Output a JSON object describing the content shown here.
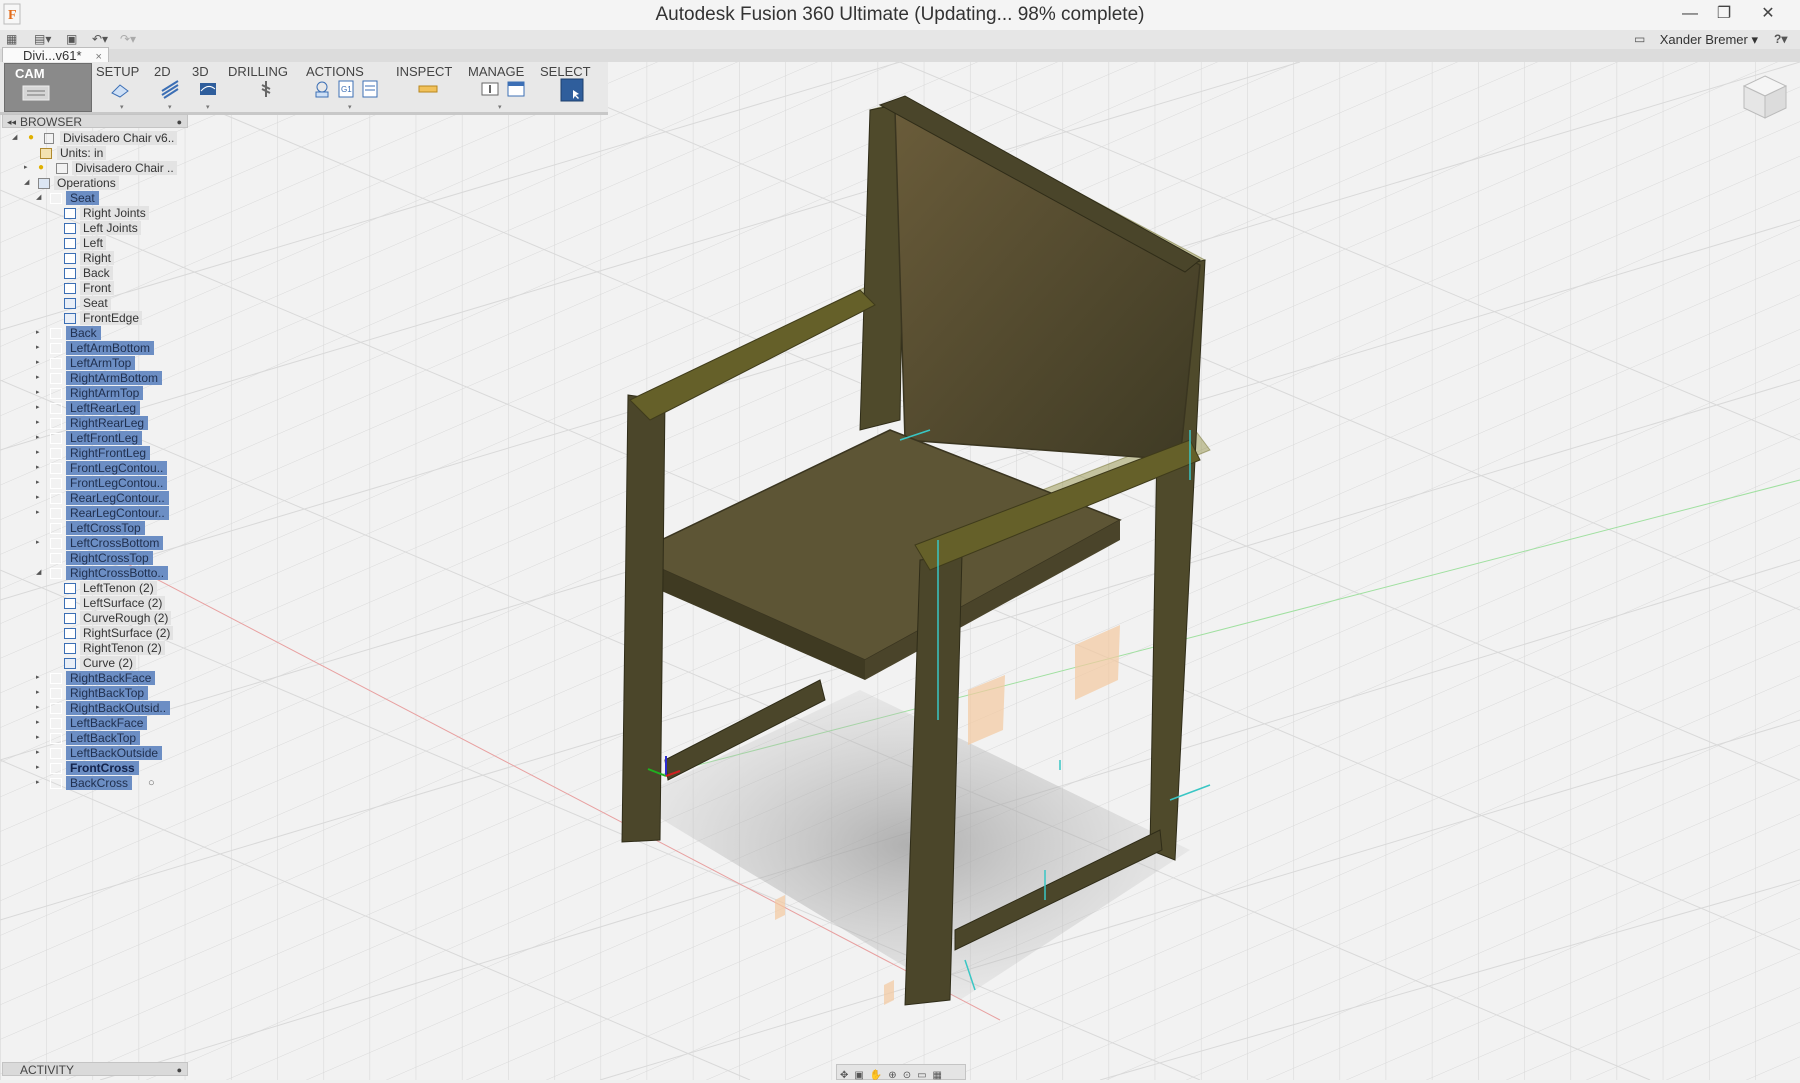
{
  "window": {
    "title": "Autodesk Fusion 360 Ultimate  (Updating... 98% complete)",
    "controls": [
      "—",
      "❐",
      "✕"
    ]
  },
  "quick_access": {
    "icons": [
      "grid-icon",
      "file-icon",
      "save-icon",
      "undo-icon",
      "redo-icon"
    ],
    "user_name": "Xander Bremer",
    "help_label": "?"
  },
  "document_tab": {
    "label": "Divi...v61*",
    "close": "×"
  },
  "toolbar": {
    "workspace": "CAM",
    "groups": [
      {
        "label": "SETUP"
      },
      {
        "label": "2D"
      },
      {
        "label": "3D"
      },
      {
        "label": "DRILLING"
      },
      {
        "label": "ACTIONS"
      },
      {
        "label": "INSPECT"
      },
      {
        "label": "MANAGE"
      },
      {
        "label": "SELECT"
      }
    ]
  },
  "browser": {
    "header": "BROWSER",
    "nodes": [
      {
        "label": "Divisadero Chair v6..",
        "style": "grey"
      },
      {
        "label": "Units: in",
        "style": "grey"
      },
      {
        "label": "Divisadero Chair ..",
        "style": "grey"
      },
      {
        "label": "Operations",
        "style": "grey"
      },
      {
        "label": "Seat",
        "style": "sel"
      },
      {
        "label": "Right Joints",
        "style": "grey"
      },
      {
        "label": "Left Joints",
        "style": "grey"
      },
      {
        "label": "Left",
        "style": "grey"
      },
      {
        "label": "Right",
        "style": "grey"
      },
      {
        "label": "Back",
        "style": "grey"
      },
      {
        "label": "Front",
        "style": "grey"
      },
      {
        "label": "Seat",
        "style": "grey"
      },
      {
        "label": "FrontEdge",
        "style": "grey"
      },
      {
        "label": "Back",
        "style": "sel"
      },
      {
        "label": "LeftArmBottom",
        "style": "sel"
      },
      {
        "label": "LeftArmTop",
        "style": "sel"
      },
      {
        "label": "RightArmBottom",
        "style": "sel"
      },
      {
        "label": "RightArmTop",
        "style": "sel"
      },
      {
        "label": "LeftRearLeg",
        "style": "sel"
      },
      {
        "label": "RightRearLeg",
        "style": "sel"
      },
      {
        "label": "LeftFrontLeg",
        "style": "sel"
      },
      {
        "label": "RightFrontLeg",
        "style": "sel"
      },
      {
        "label": "FrontLegContou..",
        "style": "sel"
      },
      {
        "label": "FrontLegContou..",
        "style": "sel"
      },
      {
        "label": "RearLegContour..",
        "style": "sel"
      },
      {
        "label": "RearLegContour..",
        "style": "sel"
      },
      {
        "label": "LeftCrossTop",
        "style": "sel"
      },
      {
        "label": "LeftCrossBottom",
        "style": "sel"
      },
      {
        "label": "RightCrossTop",
        "style": "sel"
      },
      {
        "label": "RightCrossBotto..",
        "style": "sel"
      },
      {
        "label": "LeftTenon (2)",
        "style": "grey"
      },
      {
        "label": "LeftSurface (2)",
        "style": "grey"
      },
      {
        "label": "CurveRough (2)",
        "style": "grey"
      },
      {
        "label": "RightSurface (2)",
        "style": "grey"
      },
      {
        "label": "RightTenon (2)",
        "style": "grey"
      },
      {
        "label": "Curve (2)",
        "style": "grey"
      },
      {
        "label": "RightBackFace",
        "style": "sel"
      },
      {
        "label": "RightBackTop",
        "style": "sel"
      },
      {
        "label": "RightBackOutsid..",
        "style": "sel"
      },
      {
        "label": "LeftBackFace",
        "style": "sel"
      },
      {
        "label": "LeftBackTop",
        "style": "sel"
      },
      {
        "label": "LeftBackOutside",
        "style": "sel"
      },
      {
        "label": "FrontCross",
        "style": "sel"
      },
      {
        "label": "BackCross",
        "style": "sel"
      }
    ]
  },
  "activity": {
    "header": "ACTIVITY"
  },
  "navigation_bar": {
    "icons": [
      "orbit-icon",
      "look-at-icon",
      "pan-icon",
      "zoom-icon",
      "fit-icon",
      "display-settings-icon",
      "grid-settings-icon"
    ]
  },
  "colors": {
    "selection": "#6c8ec4",
    "chair_wood": "#5a5232",
    "chair_ghost": "#8c8a3a",
    "toolpath": "#39c6c4"
  }
}
